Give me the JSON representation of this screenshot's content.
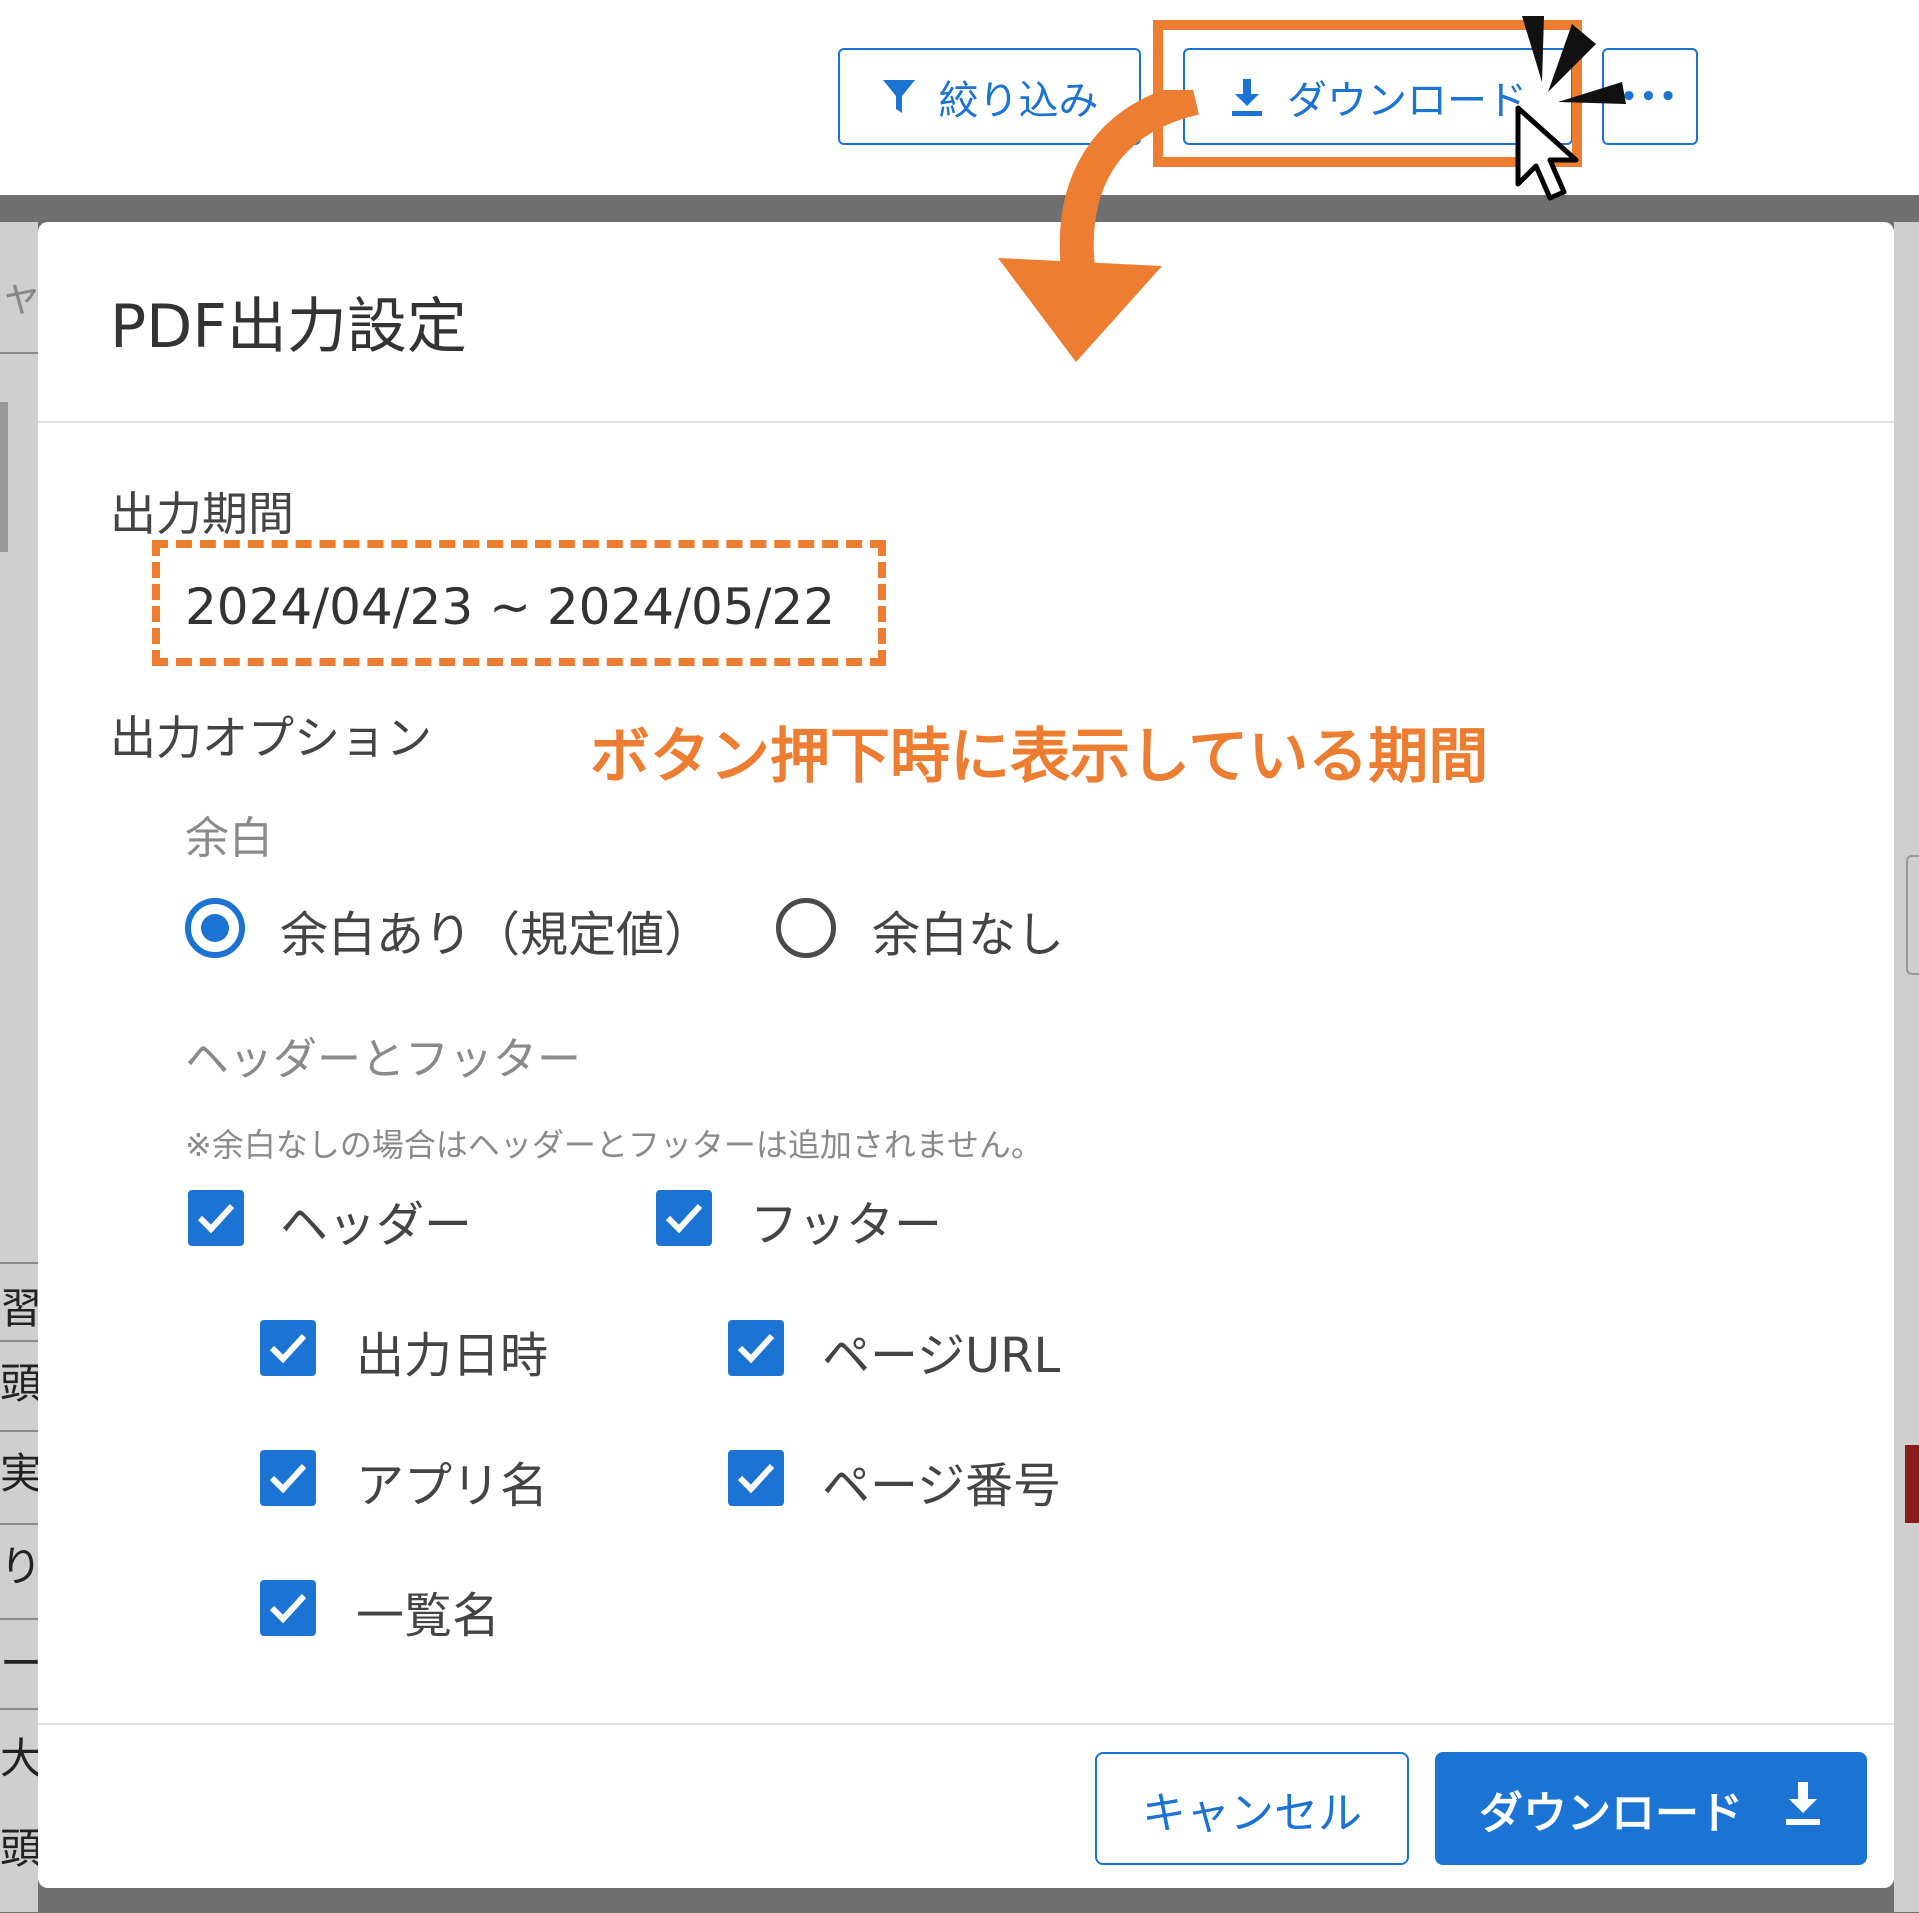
{
  "toolbar": {
    "filter_label": "絞り込み",
    "download_label": "ダウンロード",
    "more_label": "•••"
  },
  "background": {
    "left_glyphs": [
      "ャ",
      "習",
      "頭",
      "実",
      "り",
      "ー",
      "大",
      "頭"
    ]
  },
  "dialog": {
    "title": "PDF出力設定",
    "period_label": "出力期間",
    "period_value": "2024/04/23 ~ 2024/05/22",
    "options_label": "出力オプション",
    "margin_label": "余白",
    "margin_options": [
      {
        "label": "余白あり（規定値）",
        "selected": true
      },
      {
        "label": "余白なし",
        "selected": false
      }
    ],
    "header_footer_label": "ヘッダーとフッター",
    "header_footer_note": "※余白なしの場合はヘッダーとフッターは追加されません。",
    "checkboxes": {
      "header": {
        "label": "ヘッダー",
        "checked": true
      },
      "footer": {
        "label": "フッター",
        "checked": true
      },
      "output_datetime": {
        "label": "出力日時",
        "checked": true
      },
      "page_url": {
        "label": "ページURL",
        "checked": true
      },
      "app_name": {
        "label": "アプリ名",
        "checked": true
      },
      "page_number": {
        "label": "ページ番号",
        "checked": true
      },
      "list_name": {
        "label": "一覧名",
        "checked": true
      }
    },
    "cancel_label": "キャンセル",
    "download_label": "ダウンロード"
  },
  "annotation": {
    "caption": "ボタン押下時に表示している期間",
    "accent_color": "#ed7d31"
  },
  "colors": {
    "primary": "#1b73d3",
    "overlay": "#6f6f6f"
  }
}
